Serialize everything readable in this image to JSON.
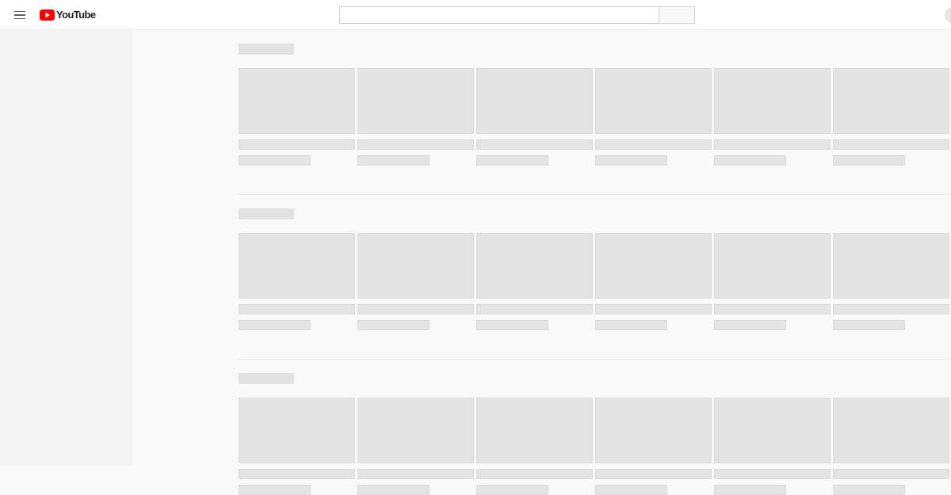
{
  "masthead": {
    "logo_text": "YouTube",
    "search": {
      "value": "",
      "placeholder": ""
    }
  },
  "colors": {
    "brand_red": "#ff0000",
    "placeholder_gray": "#e4e4e4",
    "guide_bg": "#f4f4f4",
    "page_bg": "#f9f9f9"
  },
  "icons": {
    "menu": "hamburger-menu-icon",
    "logo": "youtube-logo-icon"
  },
  "shelves_count": 3,
  "cards_per_shelf": 6
}
